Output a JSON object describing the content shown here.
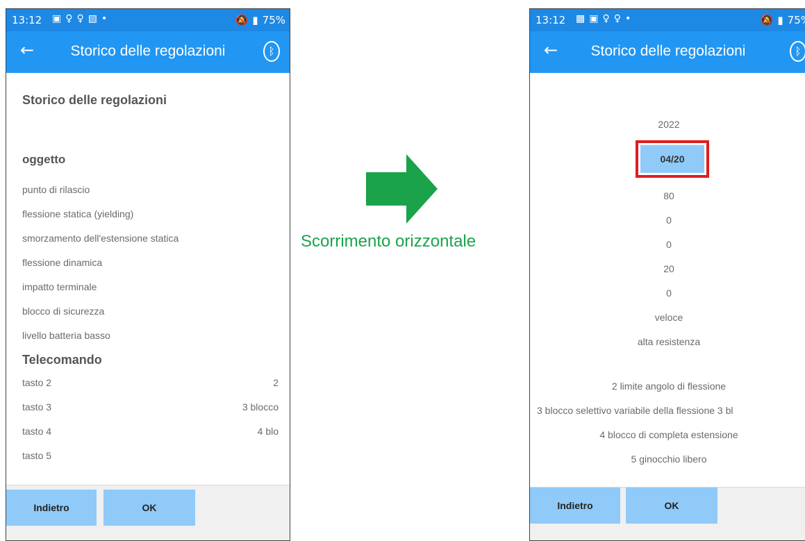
{
  "status_bar": {
    "time": "13:12",
    "battery": "75%"
  },
  "accent_colors": {
    "toolbar": "#2196f3",
    "button": "#90caf9",
    "highlight": "#e01e1e",
    "arrow": "#1aa34a"
  },
  "toolbar": {
    "title": "Storico delle regolazioni"
  },
  "left_screen": {
    "page_heading": "Storico delle regolazioni",
    "section_object": "oggetto",
    "object_items": [
      "punto di rilascio",
      "flessione statica (yielding)",
      "smorzamento dell'estensione statica",
      "flessione dinamica",
      "impatto terminale",
      "blocco di sicurezza",
      "livello batteria basso"
    ],
    "section_remote": "Telecomando",
    "remote_rows": [
      {
        "label": "tasto 2",
        "value": "2"
      },
      {
        "label": "tasto 3",
        "value": "3 blocco"
      },
      {
        "label": "tasto 4",
        "value": "4 blo"
      },
      {
        "label": "tasto 5",
        "value": ""
      }
    ]
  },
  "right_screen": {
    "year": "2022",
    "date": "04/20",
    "values": [
      "80",
      "0",
      "0",
      "20",
      "0",
      "veloce",
      "alta resistenza"
    ],
    "remote_values": [
      "2 limite angolo di flessione",
      "3 blocco selettivo variabile della flessione  3 bl",
      "4 blocco di completa estensione",
      "5 ginocchio libero"
    ]
  },
  "buttons": {
    "back": "Indietro",
    "ok": "OK"
  },
  "annotation": {
    "label": "Scorrimento orizzontale"
  }
}
